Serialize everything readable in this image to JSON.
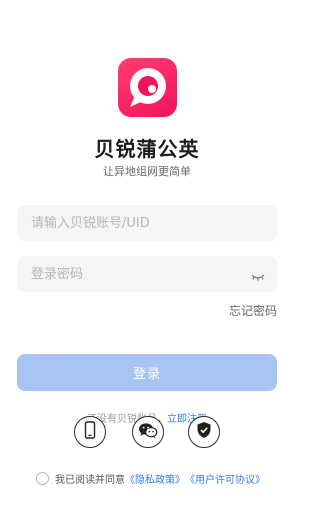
{
  "app": {
    "name": "贝锐蒲公英",
    "slogan": "让异地组网更简单",
    "logo_color": "#f31f61"
  },
  "form": {
    "account_placeholder": "请输入贝锐账号/UID",
    "password_placeholder": "登录密码",
    "password_toggle_icon": "eye-closed-icon",
    "forgot_password": "忘记密码",
    "login_button": "登录",
    "login_button_color": "#a7c4f3"
  },
  "register": {
    "prompt": "还没有贝锐账号，",
    "link": "立即注册",
    "link_color": "#3b79e8"
  },
  "social_login": [
    {
      "icon": "phone-icon",
      "name": "phone-login"
    },
    {
      "icon": "wechat-icon",
      "name": "wechat-login"
    },
    {
      "icon": "shield-check-icon",
      "name": "security-login"
    }
  ],
  "agreement": {
    "prefix": "我已阅读并同意",
    "privacy": "《隐私政策》",
    "license": "《用户许可协议》"
  }
}
